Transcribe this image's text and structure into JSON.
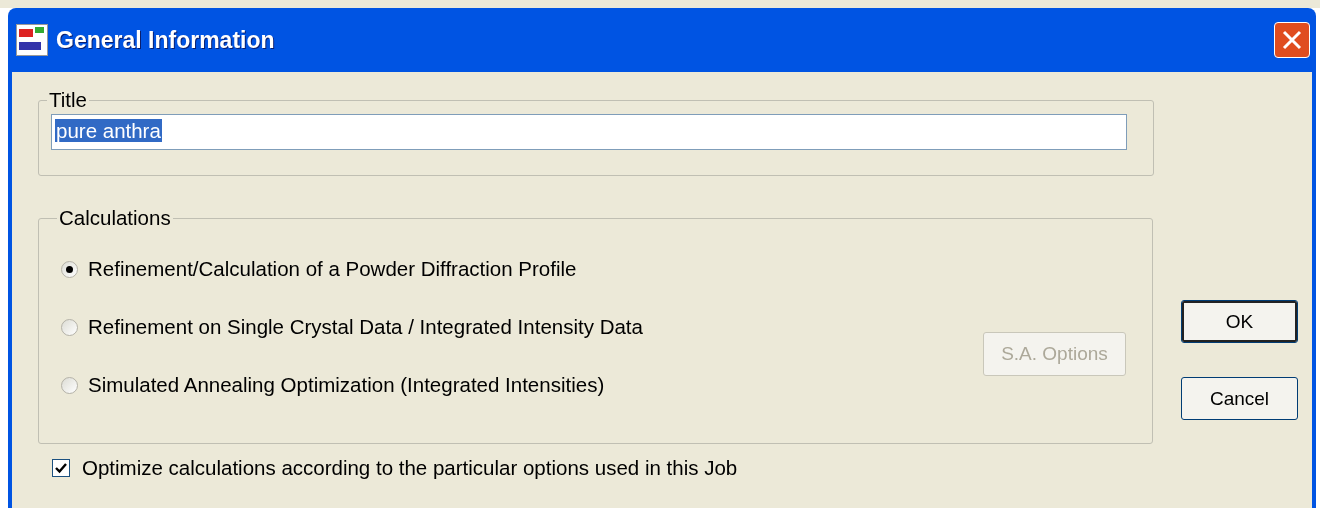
{
  "window": {
    "title": "General Information"
  },
  "title_group": {
    "label": "Title",
    "value": "pure anthra",
    "text_selected": true
  },
  "calculations": {
    "label": "Calculations",
    "options": [
      {
        "label": "Refinement/Calculation of a Powder Diffraction Profile",
        "selected": true
      },
      {
        "label": "Refinement on Single Crystal Data / Integrated Intensity Data",
        "selected": false
      },
      {
        "label": "Simulated Annealing Optimization (Integrated Intensities)",
        "selected": false
      }
    ],
    "sa_options_button": {
      "label": "S.A. Options",
      "disabled": true
    }
  },
  "optimize": {
    "label": "Optimize calculations according to the particular options used in this Job",
    "checked": true
  },
  "buttons": [
    {
      "label": "OK",
      "default": true
    },
    {
      "label": "Cancel",
      "default": false
    }
  ]
}
